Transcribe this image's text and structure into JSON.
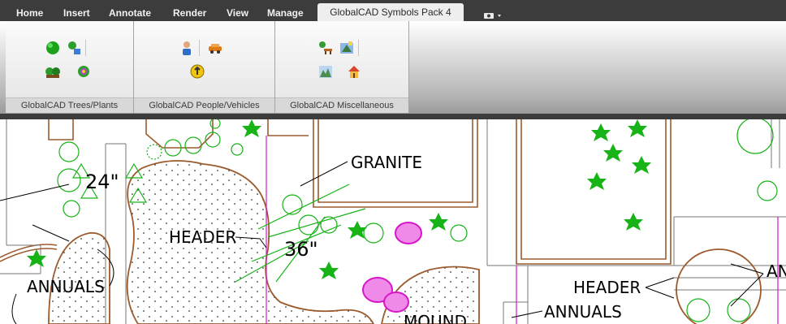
{
  "tabs": [
    "Home",
    "Insert",
    "Annotate",
    "Render",
    "View",
    "Manage",
    "GlobalCAD Symbols Pack 4"
  ],
  "active_tab": "GlobalCAD Symbols Pack 4",
  "extra_tab_icon": "camera-icon",
  "panels": [
    {
      "label": "GlobalCAD Trees/Plants",
      "icons": [
        "green-tree-icon",
        "potted-plant-icon",
        "shrubs-icon",
        "flower-icon"
      ]
    },
    {
      "label": "GlobalCAD People/Vehicles",
      "icons": [
        "person-icon",
        "car-icon",
        "sign-icon"
      ]
    },
    {
      "label": "GlobalCAD Miscellaneous",
      "icons": [
        "bench-icon",
        "fountain-icon",
        "landscape-icon",
        "playground-icon"
      ]
    }
  ],
  "drawing": {
    "labels": {
      "granite": "GRANITE",
      "header_left": "HEADER",
      "header_right": "HEADER",
      "size_24": "24\"",
      "size_36": "36\"",
      "annuals_left": "ANNUALS",
      "annuals_right": "ANNUALS",
      "mound": "MOUND",
      "cut_right": "AN"
    }
  },
  "colors": {
    "tab_bar": "#3c3c3c",
    "plant_green": "#17b317",
    "border_brown": "#9c5a2d",
    "magenta": "#d617c8"
  }
}
